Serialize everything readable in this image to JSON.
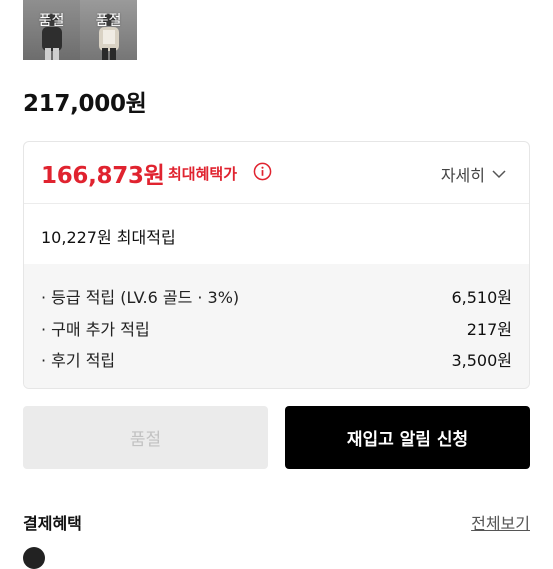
{
  "thumbnails": [
    {
      "label": "품절"
    },
    {
      "label": "품절"
    }
  ],
  "product": {
    "price": "217,000원"
  },
  "benefit": {
    "max_price": "166,873원",
    "max_label": "최대혜택가",
    "detail_label": "자세히",
    "points_total": "10,227원 최대적립",
    "breakdown": [
      {
        "label": "· 등급 적립 (LV.6 골드 · 3%)",
        "value": "6,510원"
      },
      {
        "label": "· 구매 추가 적립",
        "value": "217원"
      },
      {
        "label": "· 후기 적립",
        "value": "3,500원"
      }
    ]
  },
  "buttons": {
    "sold_out": "품절",
    "restock": "재입고 알림 신청"
  },
  "payment": {
    "title": "결제혜택",
    "see_all": "전체보기"
  },
  "colors": {
    "accent_red": "#e0232f",
    "primary_black": "#000000"
  }
}
